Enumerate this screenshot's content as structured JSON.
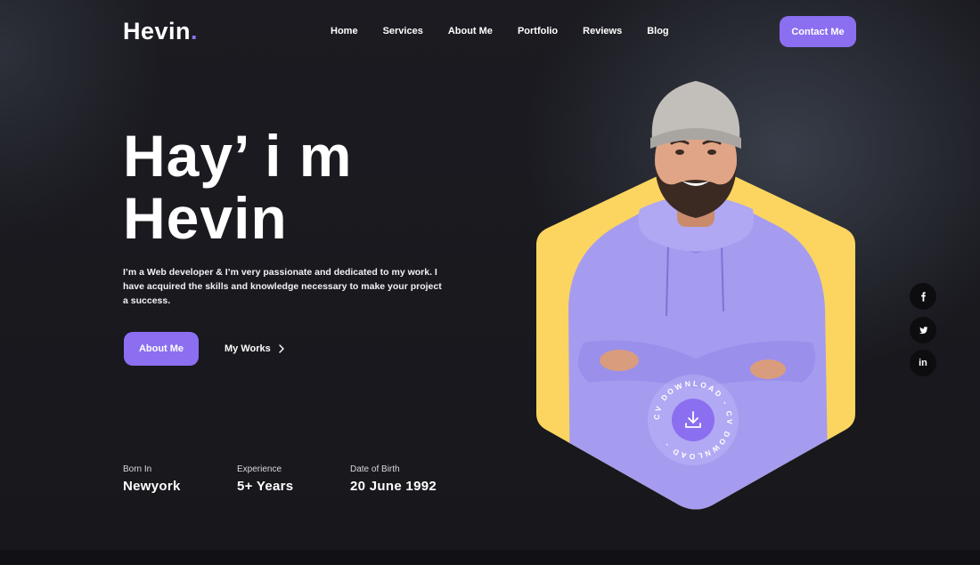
{
  "brand": {
    "name": "Hevin",
    "dot": ".",
    "accent": "#8b6ff0"
  },
  "nav": {
    "items": [
      {
        "label": "Home"
      },
      {
        "label": "Services"
      },
      {
        "label": "About Me"
      },
      {
        "label": "Portfolio"
      },
      {
        "label": "Reviews"
      },
      {
        "label": "Blog"
      }
    ],
    "contact_label": "Contact Me"
  },
  "hero": {
    "title_line1": "Hay’ i m",
    "title_line2": "Hevin",
    "description": "I’m a Web developer & I’m very passionate and dedicated to my work. I have acquired the skills and knowledge necessary to make your project a success.",
    "about_label": "About Me",
    "works_label": "My Works"
  },
  "stats": [
    {
      "label": "Born In",
      "value": "Newyork"
    },
    {
      "label": "Experience",
      "value": "5+ Years"
    },
    {
      "label": "Date of Birth",
      "value": "20 June 1992"
    }
  ],
  "cv": {
    "ring_text": "CV DOWNLOAD - CV DOWNLOAD - "
  },
  "social": [
    {
      "icon": "facebook-icon"
    },
    {
      "icon": "twitter-icon"
    },
    {
      "icon": "linkedin-icon",
      "glyph": "in"
    }
  ],
  "colors": {
    "background": "#17171c",
    "accent": "#8b6ff0",
    "hexagon": "#fbd560",
    "hoodie": "#a59cf0",
    "social_bg": "#0d0d10"
  }
}
